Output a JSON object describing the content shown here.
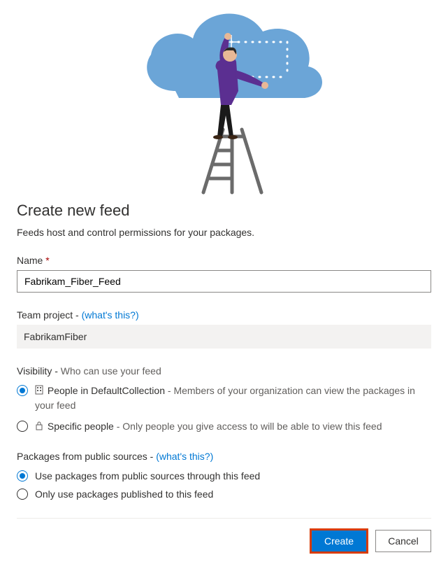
{
  "heading": "Create new feed",
  "subtitle": "Feeds host and control permissions for your packages.",
  "name_field": {
    "label": "Name",
    "required_marker": "*",
    "value": "Fabrikam_Fiber_Feed"
  },
  "team_project": {
    "label": "Team project - ",
    "hint_label": "(what's this?)",
    "value": "FabrikamFiber"
  },
  "visibility": {
    "section_label": "Visibility - ",
    "section_sub": "Who can use your feed",
    "options": [
      {
        "title": "People in DefaultCollection",
        "desc": " - Members of your organization can view the packages in your feed",
        "selected": true
      },
      {
        "title": "Specific people",
        "desc": " - Only people you give access to will be able to view this feed",
        "selected": false
      }
    ]
  },
  "public_sources": {
    "section_label": "Packages from public sources - ",
    "hint_label": "(what's this?)",
    "options": [
      {
        "title": "Use packages from public sources through this feed",
        "selected": true
      },
      {
        "title": "Only use packages published to this feed",
        "selected": false
      }
    ]
  },
  "buttons": {
    "create": "Create",
    "cancel": "Cancel"
  }
}
